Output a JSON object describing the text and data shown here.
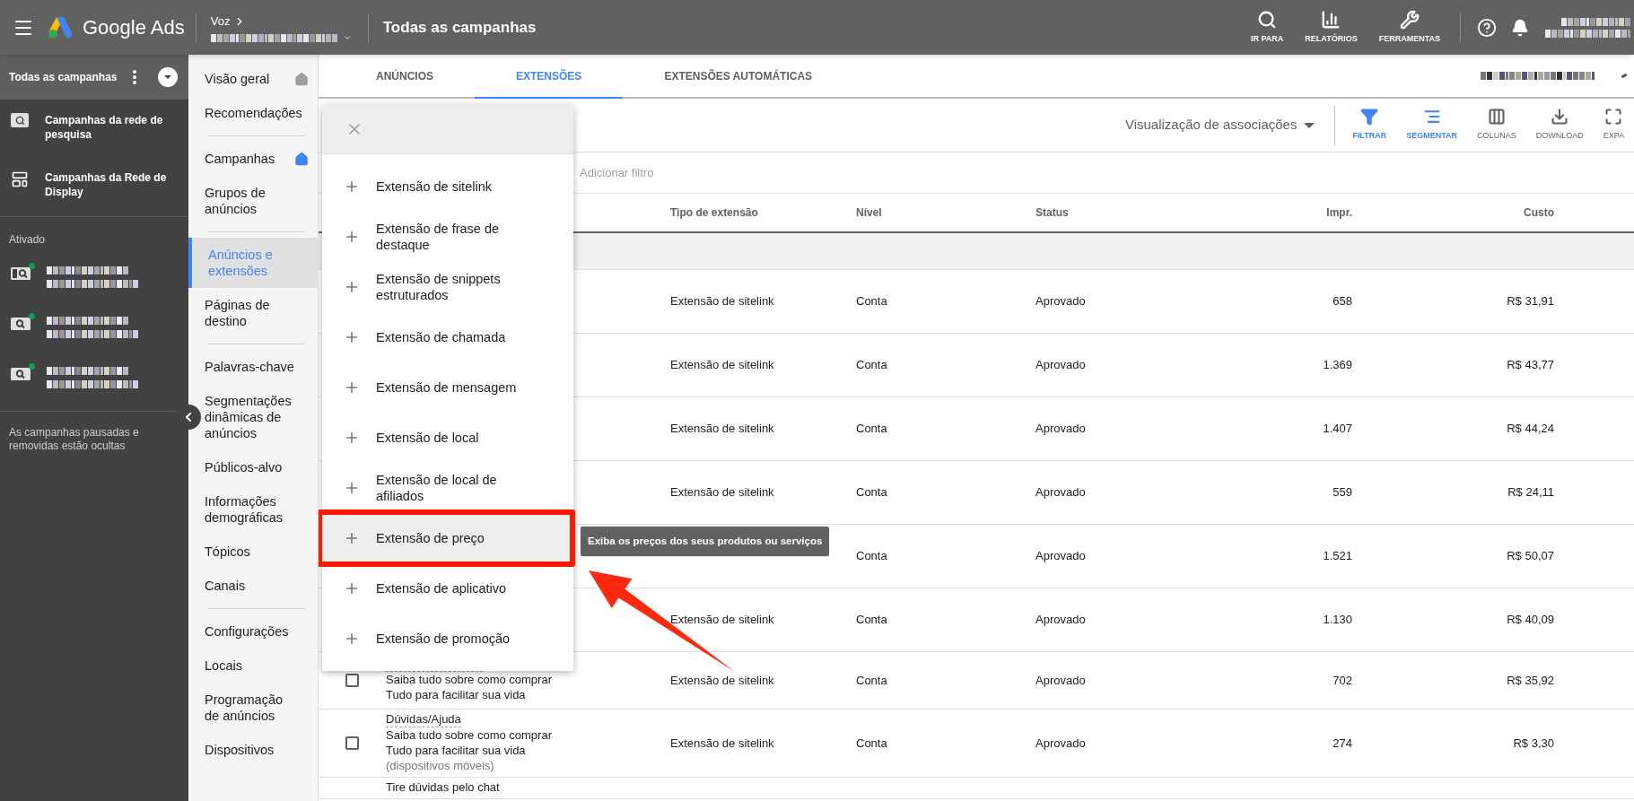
{
  "topbar": {
    "product": "Google Ads",
    "breadcrumb": "Voz",
    "title": "Todas as campanhas",
    "actions": [
      {
        "kind": "search",
        "label": "IR PARA"
      },
      {
        "kind": "reports",
        "label": "RELATÓRIOS"
      },
      {
        "kind": "tools",
        "label": "FERRAMENTAS"
      }
    ]
  },
  "campaign_panel": {
    "header": "Todas as campanhas",
    "types": [
      {
        "kind": "search",
        "label": "Campanhas da rede de pesquisa"
      },
      {
        "kind": "display",
        "label": "Campanhas da Rede de Display"
      }
    ],
    "section": "Ativado",
    "active_count_icons": [
      {
        "kind": "video"
      },
      {
        "kind": "search"
      },
      {
        "kind": "search"
      }
    ],
    "footer": "As campanhas pausadas e removidas estão ocultas"
  },
  "nav": {
    "sections": [
      {
        "items": [
          {
            "label": "Visão geral",
            "selected": false,
            "kind": "home",
            "current": false
          },
          {
            "label": "Recomendações",
            "selected": false
          }
        ]
      },
      {
        "items": [
          {
            "label": "Campanhas",
            "selected": false,
            "kind": "home",
            "current": true
          },
          {
            "label": "Grupos de anúncios",
            "selected": false
          }
        ]
      },
      {
        "items": [
          {
            "label": "Anúncios e extensões",
            "selected": true
          },
          {
            "label": "Páginas de destino",
            "selected": false
          }
        ]
      },
      {
        "items": [
          {
            "label": "Palavras-chave",
            "selected": false
          },
          {
            "label": "Segmentações dinâmicas de anúncios",
            "selected": false
          },
          {
            "label": "Públicos-alvo",
            "selected": false
          },
          {
            "label": "Informações demográficas",
            "selected": false
          },
          {
            "label": "Tópicos",
            "selected": false
          },
          {
            "label": "Canais",
            "selected": false
          }
        ]
      },
      {
        "items": [
          {
            "label": "Configurações",
            "selected": false
          },
          {
            "label": "Locais",
            "selected": false
          },
          {
            "label": "Programação de anúncios",
            "selected": false
          },
          {
            "label": "Dispositivos",
            "selected": false
          }
        ]
      }
    ]
  },
  "tabs": [
    {
      "label": "ANÚNCIOS",
      "selected": false
    },
    {
      "label": "EXTENSÕES",
      "selected": true
    },
    {
      "label": "EXTENSÕES AUTOMÁTICAS",
      "selected": false
    }
  ],
  "toolbar": {
    "view": "Visualização de associações",
    "tools": [
      {
        "kind": "filter",
        "label": "FILTRAR",
        "active": true
      },
      {
        "kind": "segment",
        "label": "SEGMENTAR",
        "active": true
      },
      {
        "kind": "columns",
        "label": "COLUNAS",
        "active": false
      },
      {
        "kind": "download",
        "label": "DOWNLOAD",
        "active": false
      },
      {
        "kind": "expand",
        "label": "EXPA",
        "active": false
      }
    ]
  },
  "filter_placeholder": "Adicionar filtro",
  "table": {
    "columns": [
      "Tipo de extensão",
      "Nível",
      "Status",
      "Impr.",
      "Custo"
    ],
    "rows": [
      {
        "type": "Extensão de sitelink",
        "level": "Conta",
        "status": "Aprovado",
        "impr": "658",
        "cost": "R$ 31,91"
      },
      {
        "type": "Extensão de sitelink",
        "level": "Conta",
        "status": "Aprovado",
        "impr": "1.369",
        "cost": "R$ 43,77"
      },
      {
        "type": "Extensão de sitelink",
        "level": "Conta",
        "status": "Aprovado",
        "impr": "1.407",
        "cost": "R$ 44,24"
      },
      {
        "type": "Extensão de sitelink",
        "level": "Conta",
        "status": "Aprovado",
        "impr": "559",
        "cost": "R$ 24,11"
      },
      {
        "level": "Conta",
        "status": "Aprovado",
        "impr": "1.521",
        "cost": "R$ 50,07"
      },
      {
        "type": "Extensão de sitelink",
        "level": "Conta",
        "status": "Aprovado",
        "impr": "1.130",
        "cost": "R$ 40,09"
      },
      {
        "checked": false,
        "hidden_title": true,
        "lines": [
          "Saiba tudo sobre como comprar",
          "Tudo para facilitar sua vida"
        ],
        "type": "Extensão de sitelink",
        "level": "Conta",
        "status": "Aprovado",
        "impr": "702",
        "cost": "R$ 35,92"
      },
      {
        "checked": false,
        "title": "Dúvidas/Ajuda",
        "lines": [
          "Saiba tudo sobre como comprar",
          "Tudo para facilitar sua vida"
        ],
        "note": "(dispositivos móveis)",
        "type": "Extensão de sitelink",
        "level": "Conta",
        "status": "Aprovado",
        "impr": "274",
        "cost": "R$ 3,30"
      },
      {
        "lines": [
          "Tire dúvidas pelo chat"
        ]
      }
    ]
  },
  "menu": {
    "items": [
      {
        "label": "Extensão de sitelink",
        "highlighted": false
      },
      {
        "label": "Extensão de frase de destaque",
        "highlighted": false
      },
      {
        "label": "Extensão de snippets estruturados",
        "highlighted": false
      },
      {
        "label": "Extensão de chamada",
        "highlighted": false
      },
      {
        "label": "Extensão de mensagem",
        "highlighted": false
      },
      {
        "label": "Extensão de local",
        "highlighted": false
      },
      {
        "label": "Extensão de local de afiliados",
        "highlighted": false
      },
      {
        "label": "Extensão de preço",
        "highlighted": true
      },
      {
        "label": "Extensão de aplicativo",
        "highlighted": false
      },
      {
        "label": "Extensão de promoção",
        "highlighted": false
      }
    ],
    "tooltip": "Exiba os preços dos seus produtos ou serviços"
  }
}
